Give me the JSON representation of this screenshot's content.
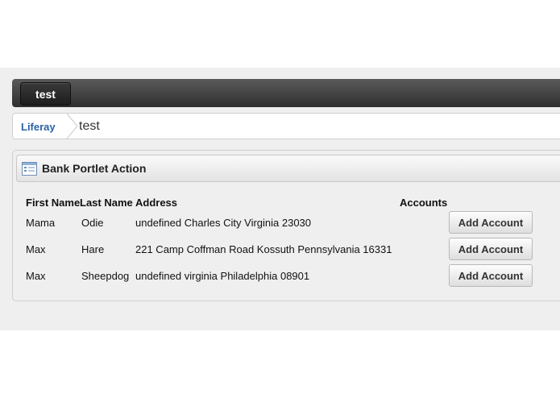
{
  "top_nav": {
    "site_tab": "test"
  },
  "breadcrumb": {
    "home": "Liferay",
    "current": "test"
  },
  "portlet": {
    "title": "Bank Portlet Action"
  },
  "table": {
    "headers": [
      "First Name",
      "Last Name",
      "Address",
      "Accounts"
    ],
    "rows": [
      {
        "first_name": "Mama",
        "last_name": "Odie",
        "address": "undefined Charles City Virginia 23030",
        "action": "Add Account"
      },
      {
        "first_name": "Max",
        "last_name": "Hare",
        "address": "221 Camp Coffman Road Kossuth Pennsylvania 16331",
        "action": "Add Account"
      },
      {
        "first_name": "Max",
        "last_name": "Sheepdog",
        "address": "undefined virginia Philadelphia 08901",
        "action": "Add Account"
      }
    ]
  },
  "icons": {
    "portlet": "portlet-table-icon",
    "separator": "breadcrumb-chevron-icon"
  },
  "colors": {
    "topbar": "#3c3c3c",
    "link": "#2a63a8",
    "band": "#efefef"
  }
}
